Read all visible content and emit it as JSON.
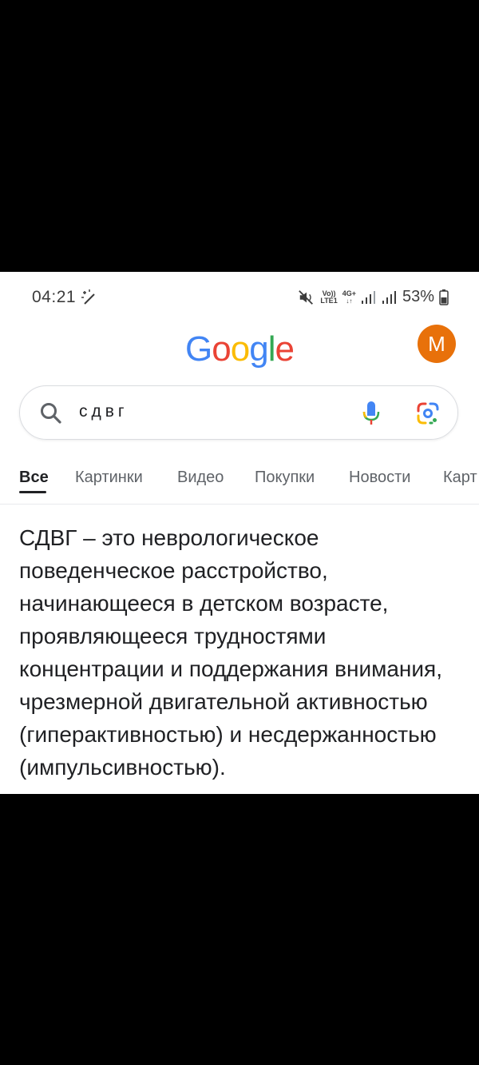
{
  "status_bar": {
    "time": "04:21",
    "volte_line1": "Vo))",
    "volte_line2": "LTE1",
    "network": "4G+",
    "battery": "53%"
  },
  "header": {
    "logo_letters": [
      {
        "char": "G",
        "color": "#4285F4"
      },
      {
        "char": "o",
        "color": "#EA4335"
      },
      {
        "char": "o",
        "color": "#FBBC05"
      },
      {
        "char": "g",
        "color": "#4285F4"
      },
      {
        "char": "l",
        "color": "#34A853"
      },
      {
        "char": "e",
        "color": "#EA4335"
      }
    ],
    "avatar_letter": "M",
    "avatar_color": "#E8710A"
  },
  "search": {
    "query": "сдвг"
  },
  "tabs": {
    "all": "Все",
    "images": "Картинки",
    "video": "Видео",
    "shopping": "Покупки",
    "news": "Новости",
    "maps": "Карт"
  },
  "answer": {
    "text": "СДВГ – это неврологическое поведенческое расстройство, начинающееся в детском возрасте, проявляющееся трудностями концентрации и поддержания внимания, чрезмерной двигательной активностью (гиперактивностью) и несдержанностью (импульсивностью)."
  },
  "icons": {
    "status_left": [
      "magic-wand-icon"
    ],
    "status_right": [
      "mute-icon",
      "volte-icon",
      "signal-icon",
      "signal-icon",
      "battery-icon"
    ],
    "search": [
      "search-icon",
      "microphone-icon",
      "google-lens-icon"
    ]
  }
}
